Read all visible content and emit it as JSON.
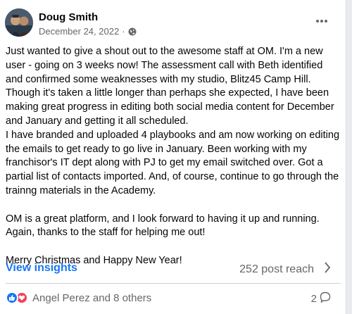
{
  "post": {
    "author": "Doug Smith",
    "date": "December 24, 2022",
    "separator": "·",
    "privacy_icon": "globe-icon",
    "more_icon": "more-options-icon",
    "paragraphs": [
      "Just wanted to give a shout out to the awesome staff at OM. I'm a new user - going on 3 weeks now! The assessment call with Beth identified and confirmed some weaknesses with my studio, Blitz45 Camp Hill. Though it's taken a little longer than perhaps she expected, I have been making great progress in editing both social media content for December and January and getting it all scheduled.\nI have branded and uploaded 4 playbooks and am now working on editing the emails to get ready to go live in January. Been working with my franchisor's IT dept along with PJ to get my email switched over. Got a partial list of contacts imported. And, of course, continue to go through the trainng materials in the Academy.",
      "OM is a great platform, and I look forward to having it up and running. Again, thanks to the staff for helping me out!",
      "Merry Christmas and Happy New Year!"
    ]
  },
  "insights": {
    "view_label": "View insights",
    "reach_label": "252 post reach",
    "chevron_icon": "chevron-right-icon"
  },
  "footer": {
    "reaction_icons": [
      "like-icon",
      "love-icon"
    ],
    "reaction_names": "Angel Perez and 8 others",
    "comment_count": "2",
    "comment_icon": "comment-icon"
  },
  "colors": {
    "link_blue": "#1877f2",
    "muted_text": "#65676b",
    "like_blue": "#1877f2",
    "love_red": "#f33e58"
  }
}
